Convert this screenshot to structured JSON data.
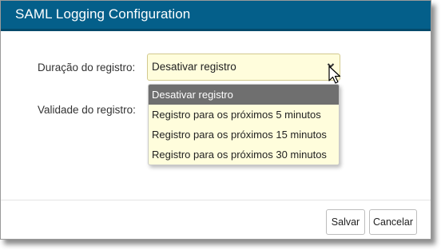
{
  "dialog": {
    "title": "SAML Logging Configuration"
  },
  "form": {
    "duration_label": "Duração do registro:",
    "validity_label": "Validade do registro:",
    "duration_value": "Desativar registro"
  },
  "dropdown": {
    "options": [
      "Desativar registro",
      "Registro para os próximos 5 minutos",
      "Registro para os próximos 15 minutos",
      "Registro para os próximos 30 minutos"
    ],
    "selected_index": 0
  },
  "buttons": {
    "save": "Salvar",
    "cancel": "Cancelar"
  },
  "icons": {
    "chevron": "chevron-down-icon",
    "cursor": "mouse-pointer-icon"
  },
  "colors": {
    "titlebar": "#045f8a",
    "field_background": "#fffddc",
    "selected_option": "#6f6f6f"
  }
}
